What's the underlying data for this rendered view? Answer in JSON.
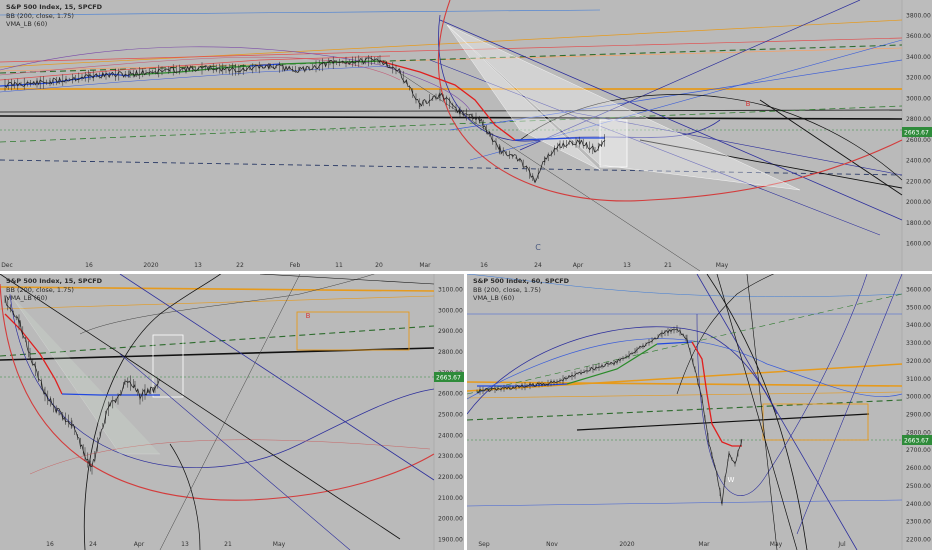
{
  "panes": [
    {
      "id": "top",
      "legend": {
        "symbol": "S&P 500 Index, 15, SPCFD",
        "bb": "BB (200, close, 1.75)",
        "vma": "VMA_LB (60)"
      },
      "y_ticks": [
        "3800.00",
        "3600.00",
        "3400.00",
        "3200.00",
        "3000.00",
        "2800.00",
        "2600.00",
        "2400.00",
        "2200.00",
        "2000.00",
        "1800.00",
        "1600.00"
      ],
      "x_ticks": [
        "Dec",
        "16",
        "2020",
        "13",
        "22",
        "Feb",
        "11",
        "20",
        "Mar",
        "16",
        "24",
        "Apr",
        "13",
        "21",
        "May"
      ],
      "price_label": "2663.67",
      "annotations": [
        "C",
        "B"
      ],
      "chart_data": {
        "type": "line",
        "title": "S&P 500 Index, 15, SPCFD",
        "xlabel": "",
        "ylabel": "",
        "ylim": [
          1500,
          3900
        ],
        "x": [
          "Dec",
          "16",
          "2020",
          "13",
          "22",
          "Feb",
          "11",
          "20",
          "Mar",
          "16",
          "24",
          "Apr",
          "13",
          "21",
          "May"
        ],
        "series": [
          {
            "name": "S&P 500 Index, 15, SPCFD",
            "values": [
              3095,
              3150,
              3240,
              3290,
              3320,
              3250,
              3350,
              3380,
              2970,
              2600,
              2250,
              2480,
              2780
            ]
          },
          {
            "name": "BB (200, close, 1.75)",
            "values": [
              3080,
              3130,
              3220,
              3270,
              3300,
              3270,
              3330,
              3360,
              3150,
              2800,
              2500,
              2560,
              2600
            ]
          }
        ],
        "last_price": 2663.67
      }
    },
    {
      "id": "bottom-left",
      "legend": {
        "symbol": "S&P 500 Index, 15, SPCFD",
        "bb": "BB (200, close, 1.75)",
        "vma": "VMA_LB (60)"
      },
      "y_ticks": [
        "3100.00",
        "3000.00",
        "2900.00",
        "2800.00",
        "2700.00",
        "2600.00",
        "2500.00",
        "2400.00",
        "2300.00",
        "2200.00",
        "2100.00",
        "2000.00",
        "1900.00"
      ],
      "x_ticks": [
        "16",
        "24",
        "Apr",
        "13",
        "21",
        "May"
      ],
      "price_label": "2663.67",
      "annotations": [
        "B"
      ],
      "chart_data": {
        "type": "line",
        "title": "S&P 500 Index, 15, SPCFD",
        "xlabel": "",
        "ylabel": "",
        "ylim": [
          1900,
          3150
        ],
        "x": [
          "16",
          "24",
          "Apr",
          "13",
          "21",
          "May"
        ],
        "series": [
          {
            "name": "S&P 500 Index, 15, SPCFD",
            "values": [
              2900,
              2450,
              2250,
              2550,
              2620,
              2660
            ]
          }
        ],
        "last_price": 2663.67
      }
    },
    {
      "id": "bottom-right",
      "legend": {
        "symbol": "S&P 500 Index, 60, SPCFD",
        "bb": "BB (200, close, 1.75)",
        "vma": "VMA_LB (60)"
      },
      "y_ticks": [
        "3600.00",
        "3500.00",
        "3400.00",
        "3300.00",
        "3200.00",
        "3100.00",
        "3000.00",
        "2900.00",
        "2800.00",
        "2700.00",
        "2600.00",
        "2500.00",
        "2400.00",
        "2300.00",
        "2200.00"
      ],
      "x_ticks": [
        "Sep",
        "Nov",
        "2020",
        "Mar",
        "May",
        "Jul"
      ],
      "price_label": "2663.67",
      "annotations": [
        "W"
      ],
      "chart_data": {
        "type": "line",
        "title": "S&P 500 Index, 60, SPCFD",
        "xlabel": "",
        "ylabel": "",
        "ylim": [
          2150,
          3680
        ],
        "x": [
          "Sep",
          "Nov",
          "2020",
          "Mar",
          "May",
          "Jul"
        ],
        "series": [
          {
            "name": "S&P 500 Index, 60, SPCFD",
            "values": [
              2990,
              3070,
              3250,
              2300,
              2663
            ]
          }
        ],
        "last_price": 2663.67
      }
    }
  ],
  "colors": {
    "price": "#1e1e1e",
    "bb_mid_up": "#2a8a2a",
    "bb_mid_flat": "#2148e0",
    "bb_mid_down": "#e01f1f",
    "orange": "#e69a1c",
    "blue_line": "#3c5ed8",
    "navy_line": "#2d2f9c",
    "black_line": "#111111",
    "dashed_green": "#2d6b2d",
    "red_arc": "#d33c3c",
    "price_badge": "#2e8b3a",
    "fan": "#ffffff"
  }
}
